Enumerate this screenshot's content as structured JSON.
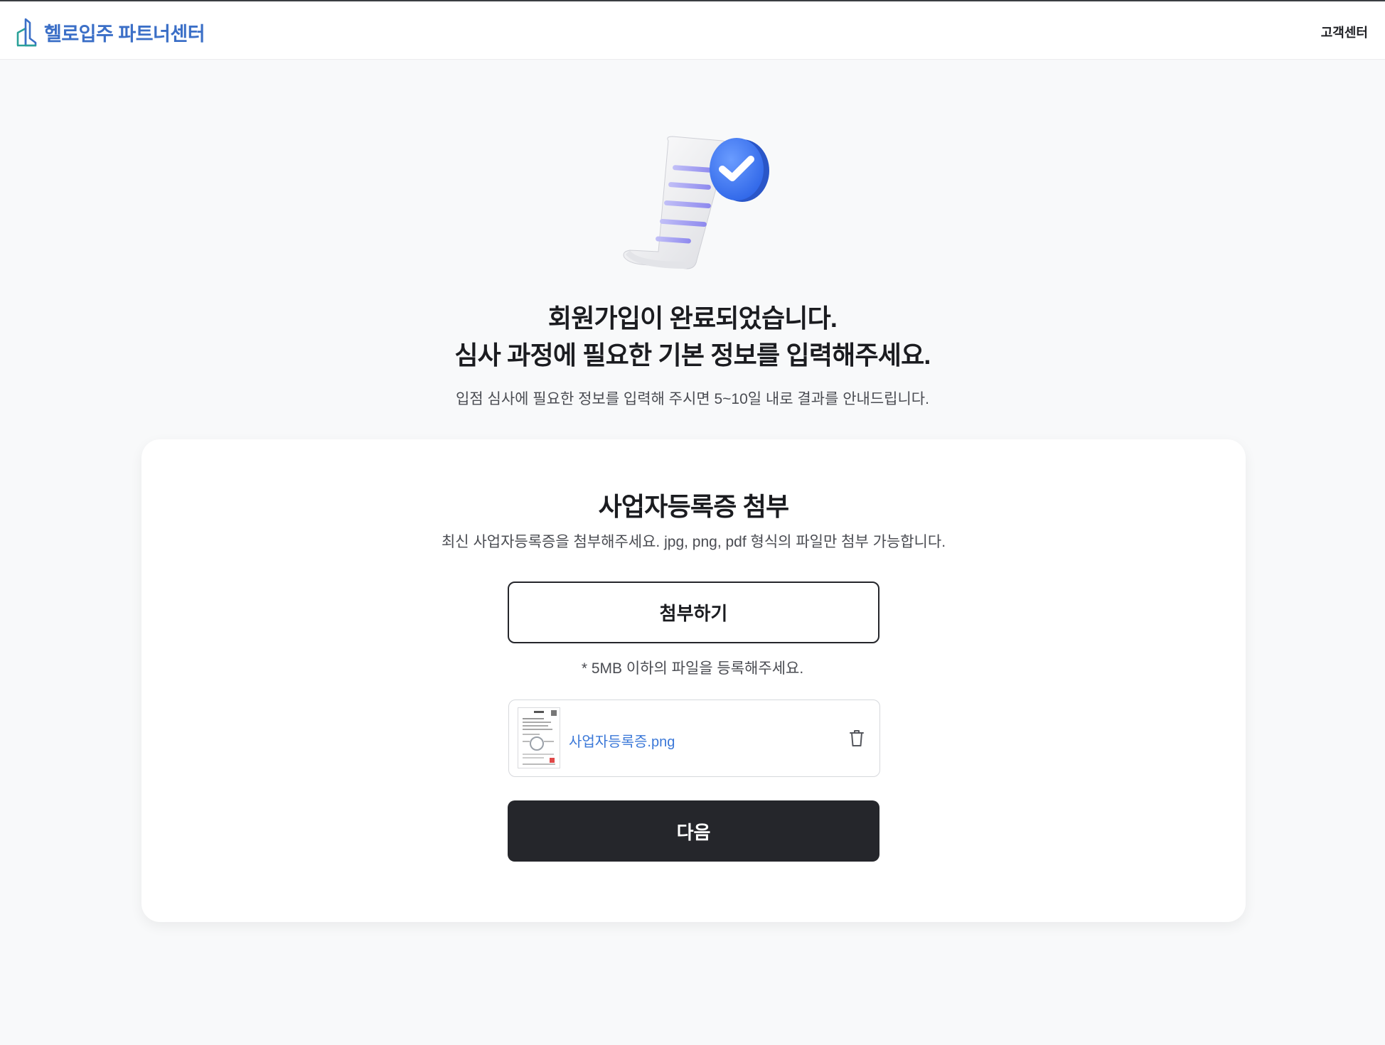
{
  "header": {
    "brand_name": "헬로입주 파트너센터",
    "logo_icon": "building-icon",
    "support_label": "고객센터"
  },
  "hero": {
    "illustration_icon": "document-check-icon",
    "headline_line1": "회원가입이 완료되었습니다.",
    "headline_line2": "심사 과정에 필요한 기본 정보를 입력해주세요.",
    "subline": "입점 심사에 필요한 정보를 입력해 주시면 5~10일 내로 결과를 안내드립니다."
  },
  "card": {
    "title": "사업자등록증 첨부",
    "description": "최신 사업자등록증을 첨부해주세요. jpg, png, pdf 형식의 파일만 첨부 가능합니다.",
    "attach_label": "첨부하기",
    "size_note": "* 5MB 이하의 파일을 등록해주세요.",
    "file": {
      "name": "사업자등록증.png",
      "thumbnail_icon": "document-thumbnail-icon",
      "delete_icon": "trash-icon"
    },
    "next_label": "다음"
  },
  "colors": {
    "brand_blue": "#3b6fc7",
    "dark_button": "#25262b",
    "link_blue": "#3b78d8",
    "background": "#f8f9fa"
  }
}
